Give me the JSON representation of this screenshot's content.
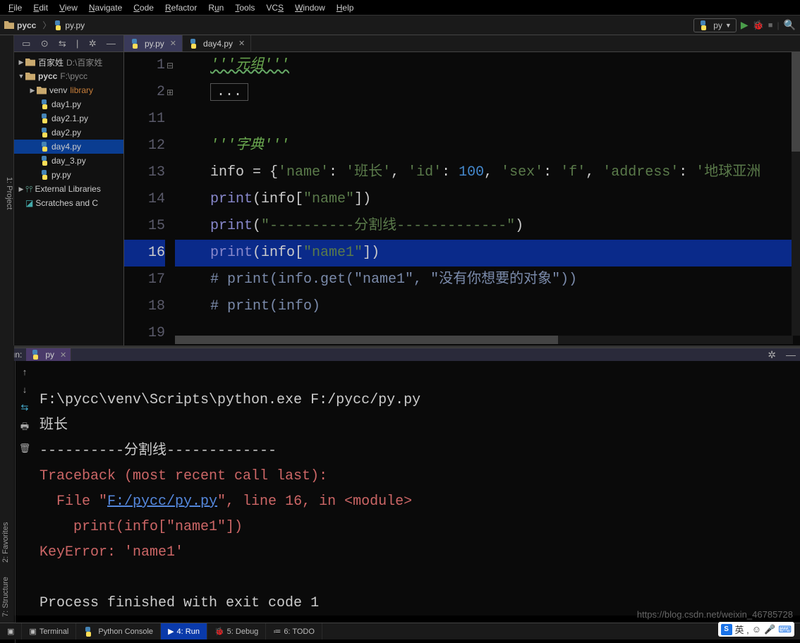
{
  "menu": [
    "File",
    "Edit",
    "View",
    "Navigate",
    "Code",
    "Refactor",
    "Run",
    "Tools",
    "VCS",
    "Window",
    "Help"
  ],
  "breadcrumb": {
    "project": "pycc",
    "file": "py.py"
  },
  "config": {
    "name": "py"
  },
  "tree": {
    "row0": {
      "name": "百家姓",
      "path": "D:\\百家姓"
    },
    "row1": {
      "name": "pycc",
      "path": "F:\\pycc"
    },
    "row2": {
      "name": "venv",
      "lib": "library"
    },
    "files": [
      "day1.py",
      "day2.1.py",
      "day2.py",
      "day4.py",
      "day_3.py",
      "py.py"
    ],
    "ext_lib": "External Libraries",
    "scratch": "Scratches and C"
  },
  "tabs": {
    "t0": "py.py",
    "t1": "day4.py"
  },
  "code": {
    "lnums": [
      "1",
      "2",
      "11",
      "12",
      "13",
      "14",
      "15",
      "16",
      "17",
      "18",
      "19"
    ],
    "l1": "'''元组'''",
    "l2": "...",
    "l12": "'''字典'''",
    "l13_a": "info = {",
    "l13_b": "'name'",
    "l13_c": ": ",
    "l13_d": "'班长'",
    "l13_e": ", ",
    "l13_f": "'id'",
    "l13_g": ": ",
    "l13_h": "100",
    "l13_i": ", ",
    "l13_j": "'sex'",
    "l13_k": ": ",
    "l13_l": "'f'",
    "l13_m": ", ",
    "l13_n": "'address'",
    "l13_o": ": ",
    "l13_p": "'地球亚洲",
    "l14_a": "print",
    "l14_b": "(info[",
    "l14_c": "\"name\"",
    "l14_d": "])",
    "l15_a": "print",
    "l15_b": "(",
    "l15_c": "\"----------分割线-------------\"",
    "l15_d": ")",
    "l16_a": "print",
    "l16_b": "(info[",
    "l16_c": "\"name1\"",
    "l16_d": "])",
    "l17": "# print(info.get(\"name1\", \"没有你想要的对象\"))",
    "l18": "# print(info)"
  },
  "run_panel": {
    "title": "Run:",
    "tab": "py",
    "out1": "F:\\pycc\\venv\\Scripts\\python.exe F:/pycc/py.py",
    "out2": "班长",
    "out3": "----------分割线-------------",
    "err1": "Traceback (most recent call last):",
    "err2a": "  File \"",
    "err2link": "F:/pycc/py.py",
    "err2b": "\", line 16, in <module>",
    "err3": "    print(info[\"name1\"])",
    "err4": "KeyError: 'name1'",
    "exit": "Process finished with exit code 1"
  },
  "status": {
    "terminal": "Terminal",
    "pyconsole": "Python Console",
    "run": "4: Run",
    "debug": "5: Debug",
    "todo": "6: TODO"
  },
  "watermark": "https://blog.csdn.net/weixin_46785728",
  "ime": "英 , ",
  "sidebar_labels": {
    "project": "1: Project",
    "fav": "2: Favorites",
    "struct": "7: Structure"
  }
}
